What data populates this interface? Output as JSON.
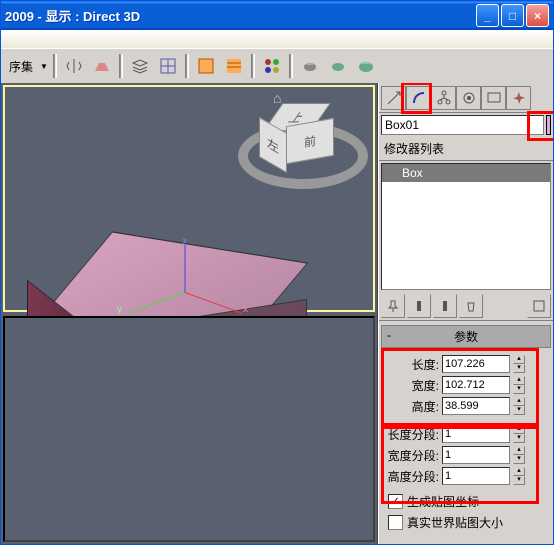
{
  "window": {
    "title": "2009     - 显示 : Direct 3D"
  },
  "toolbar": {
    "set_label": "序集"
  },
  "navcube": {
    "top": "上",
    "left": "左",
    "front": "前"
  },
  "axes": {
    "x": "x",
    "y": "y",
    "z": "z"
  },
  "side": {
    "object_name": "Box01",
    "modifier_header": "修改器列表",
    "modifier_item": "Box",
    "rollup_params": "参数",
    "params": {
      "length_lbl": "长度:",
      "length_val": "107.226",
      "width_lbl": "宽度:",
      "width_val": "102.712",
      "height_lbl": "高度:",
      "height_val": "38.599",
      "lseg_lbl": "长度分段:",
      "lseg_val": "1",
      "wseg_lbl": "宽度分段:",
      "wseg_val": "1",
      "hseg_lbl": "高度分段:",
      "hseg_val": "1"
    },
    "gen_map": "生成贴图坐标",
    "real_world": "真实世界贴图大小"
  }
}
